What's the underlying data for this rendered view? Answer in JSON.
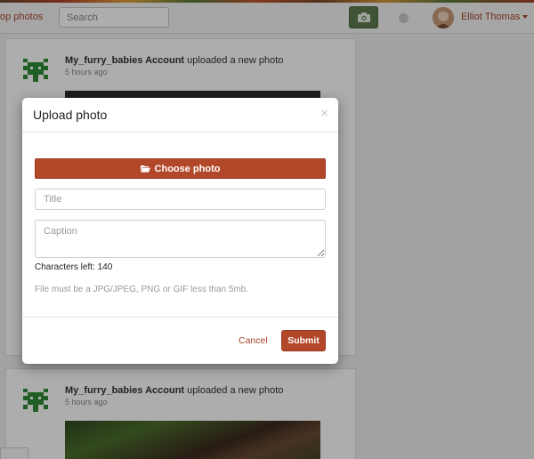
{
  "header": {
    "brand": "op photos",
    "search_placeholder": "Search",
    "user_name": "Elliot Thomas",
    "icons": {
      "camera": "camera-icon",
      "notification": "notification-dot-icon",
      "avatar": "user-avatar",
      "dropdown": "caret-down-icon"
    }
  },
  "feed": {
    "posts": [
      {
        "author": "My_furry_babies Account",
        "action": "uploaded a new photo",
        "time": "5 hours ago"
      },
      {
        "author": "My_furry_babies Account",
        "action": "uploaded a new photo",
        "time": "5 hours ago"
      }
    ]
  },
  "modal": {
    "title": "Upload photo",
    "close": "×",
    "choose_label": "Choose photo",
    "title_placeholder": "Title",
    "caption_placeholder": "Caption",
    "chars_left_label": "Characters left:",
    "chars_left": "140",
    "file_note": "File must be a JPG/JPEG, PNG or GIF less than 5mb.",
    "cancel_label": "Cancel",
    "submit_label": "Submit"
  },
  "colors": {
    "accent": "#b3472a",
    "link": "#a8432a",
    "camera_button": "#5e7d4f",
    "avatar_green": "#2e8b35"
  }
}
